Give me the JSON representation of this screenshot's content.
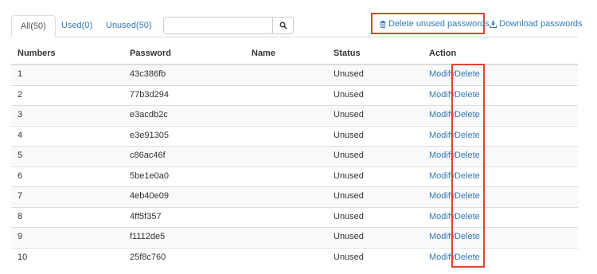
{
  "tabs": [
    {
      "label": "All(50)",
      "active": true
    },
    {
      "label": "Used(0)",
      "active": false
    },
    {
      "label": "Unused(50)",
      "active": false
    }
  ],
  "search": {
    "placeholder": "",
    "icon": "search-icon"
  },
  "actions": {
    "delete_unused_label": "Delete unused passwords.",
    "delete_unused_icon": "trash-icon",
    "download_label": "Download passwords",
    "download_icon": "download-icon"
  },
  "table": {
    "headers": [
      "Numbers",
      "Password",
      "Name",
      "Status",
      "Action"
    ],
    "modify_label": "Modify",
    "delete_label": "Delete",
    "rows": [
      {
        "number": "1",
        "password": "43c386fb",
        "name": "",
        "status": "Unused"
      },
      {
        "number": "2",
        "password": "77b3d294",
        "name": "",
        "status": "Unused"
      },
      {
        "number": "3",
        "password": "e3acdb2c",
        "name": "",
        "status": "Unused"
      },
      {
        "number": "4",
        "password": "e3e91305",
        "name": "",
        "status": "Unused"
      },
      {
        "number": "5",
        "password": "c86ac46f",
        "name": "",
        "status": "Unused"
      },
      {
        "number": "6",
        "password": "5be1e0a0",
        "name": "",
        "status": "Unused"
      },
      {
        "number": "7",
        "password": "4eb40e09",
        "name": "",
        "status": "Unused"
      },
      {
        "number": "8",
        "password": "4ff5f357",
        "name": "",
        "status": "Unused"
      },
      {
        "number": "9",
        "password": "f1112de5",
        "name": "",
        "status": "Unused"
      },
      {
        "number": "10",
        "password": "25f8c760",
        "name": "",
        "status": "Unused"
      }
    ]
  },
  "colors": {
    "link": "#337ab7",
    "highlight": "#e0452a"
  }
}
